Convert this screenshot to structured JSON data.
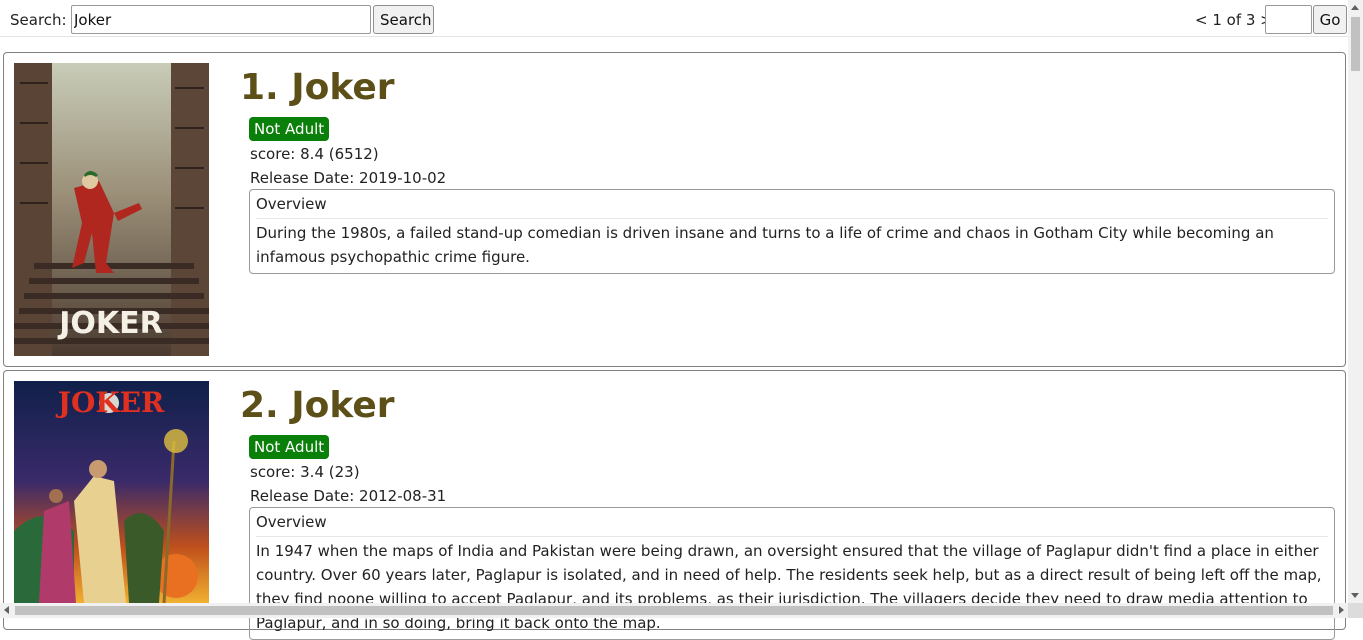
{
  "search": {
    "label": "Search:",
    "value": "Joker",
    "button_label": "Search"
  },
  "pager": {
    "text": "< 1 of 3 >",
    "page_value": "",
    "go_label": "Go"
  },
  "results": [
    {
      "title": "1. Joker",
      "badge": "Not Adult",
      "score": "score: 8.4 (6512)",
      "release": "Release Date: 2019-10-02",
      "overview_label": "Overview",
      "overview": "During the 1980s, a failed stand-up comedian is driven insane and turns to a life of crime and chaos in Gotham City while becoming an infamous psychopathic crime figure.",
      "poster_text": "JOKER"
    },
    {
      "title": "2. Joker",
      "badge": "Not Adult",
      "score": "score: 3.4 (23)",
      "release": "Release Date: 2012-08-31",
      "overview_label": "Overview",
      "overview": "In 1947 when the maps of India and Pakistan were being drawn, an oversight ensured that the village of Paglapur didn't find a place in either country. Over 60 years later, Paglapur is isolated, and in need of help. The residents seek help, but as a direct result of being left off the map, they find noone willing to accept Paglapur, and its problems, as their jurisdiction. The villagers decide they need to draw media attention to Paglapur, and in so doing, bring it back onto the map.",
      "poster_text": "JOKER"
    }
  ],
  "colors": {
    "title": "#5c4f17",
    "badge": "#0a7f0a"
  }
}
